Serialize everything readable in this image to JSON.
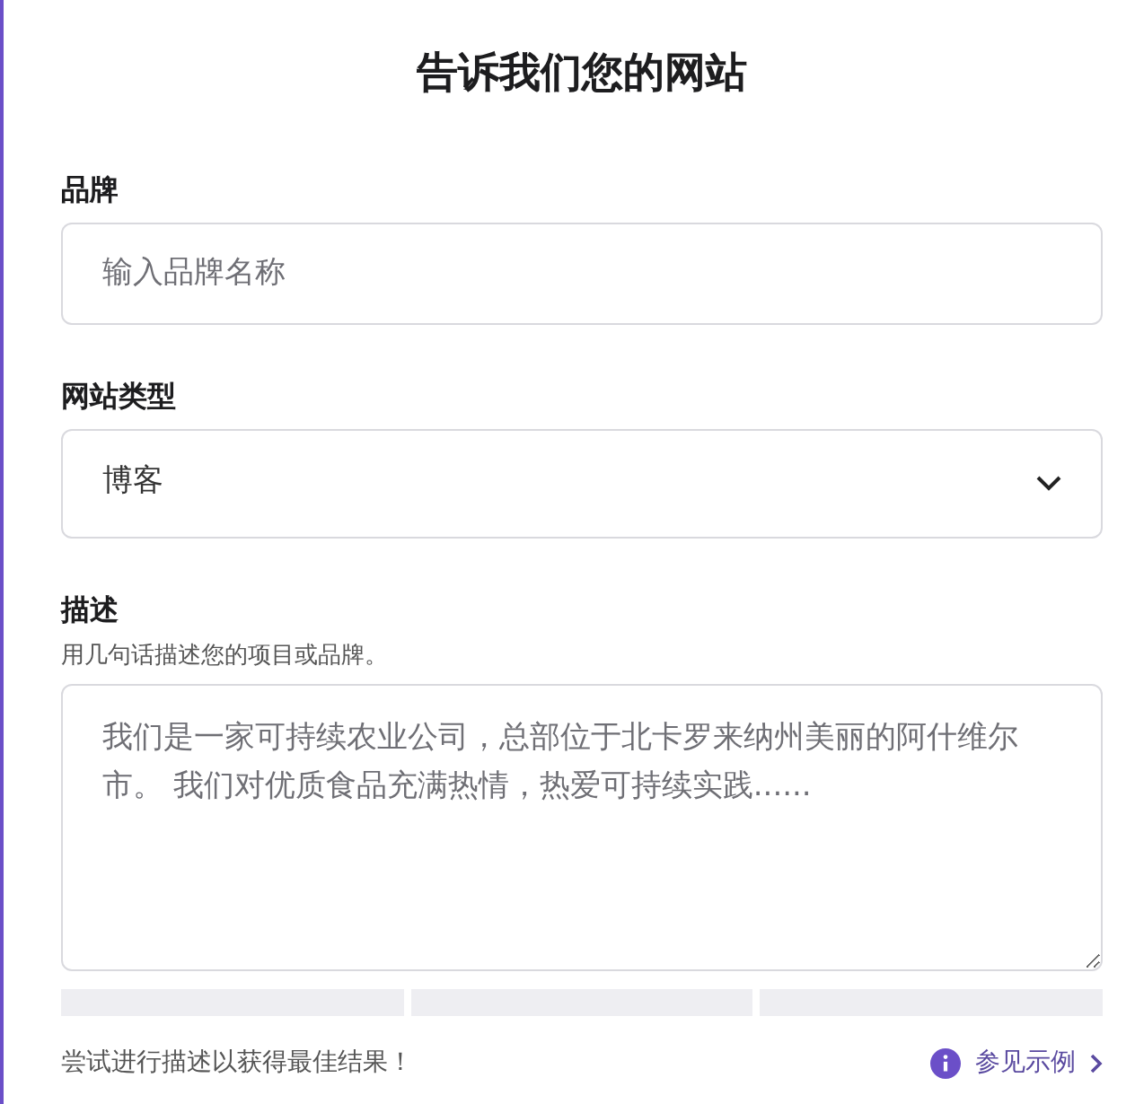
{
  "title": "告诉我们您的网站",
  "fields": [
    {
      "kind": "input",
      "label": "品牌",
      "placeholder": "输入品牌名称"
    },
    {
      "kind": "select",
      "label": "网站类型",
      "value": "博客"
    },
    {
      "kind": "textarea",
      "label": "描述",
      "hint": "用几句话描述您的项目或品牌。",
      "placeholder": "我们是一家可持续农业公司，总部位于北卡罗来纳州美丽的阿什维尔市。 我们对优质食品充满热情，热爱可持续实践......"
    }
  ],
  "strength_meter": [
    {
      "filled": false
    },
    {
      "filled": false
    },
    {
      "filled": false
    }
  ],
  "footer": {
    "tip": "尝试进行描述以获得最佳结果！",
    "link": "参见示例"
  }
}
